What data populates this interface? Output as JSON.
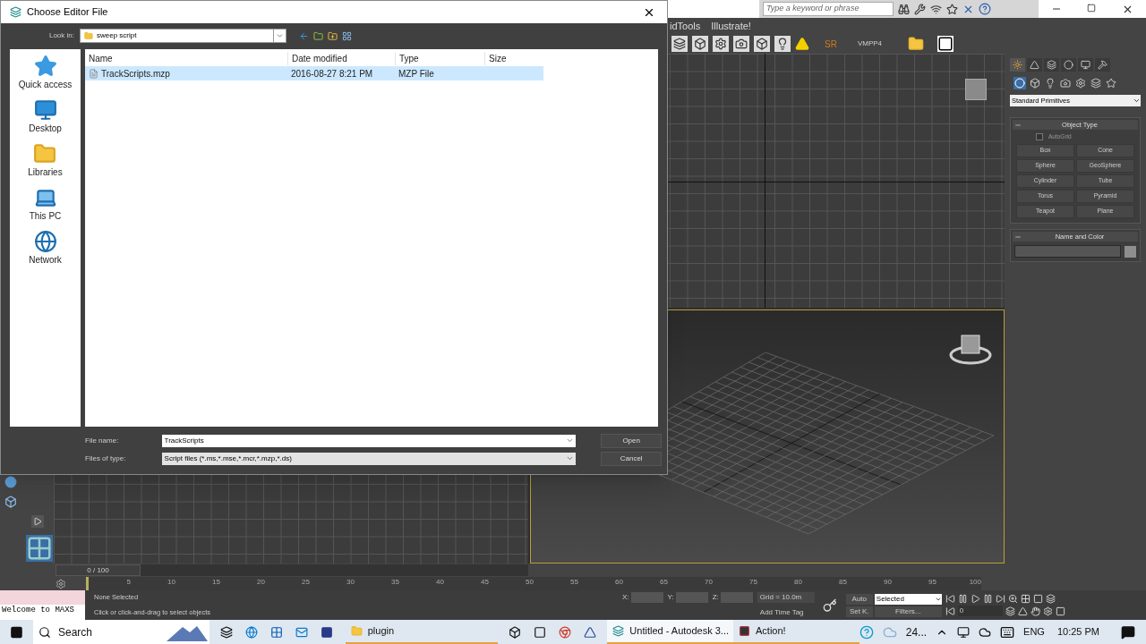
{
  "app": {
    "search_placeholder": "Type a keyword or phrase",
    "menu": [
      "idTools",
      "Illustrate!"
    ],
    "toolbar_texts": [
      "SR",
      "VMPP4"
    ]
  },
  "command_panel": {
    "dropdown": "Standard Primitives",
    "object_type": {
      "title": "Object Type",
      "expanded": true,
      "autogrid": {
        "label": "AutoGrid",
        "checked": false
      },
      "buttons": [
        "Box",
        "Cone",
        "Sphere",
        "GeoSphere",
        "Cylinder",
        "Tube",
        "Torus",
        "Pyramid",
        "Teapot",
        "Plane"
      ]
    },
    "name_and_color": {
      "title": "Name and Color",
      "expanded": true
    }
  },
  "timeline": {
    "frame_slider": "0 / 100",
    "level": 0,
    "ticks": [
      "5",
      "10",
      "15",
      "20",
      "25",
      "30",
      "35",
      "40",
      "45",
      "50",
      "55",
      "60",
      "65",
      "70",
      "75",
      "80",
      "85",
      "90",
      "95",
      "100"
    ]
  },
  "status": {
    "listener": "Welcome to MAXS",
    "selection": "None Selected",
    "prompt": "Click or click-and-drag to select objects",
    "coords": [
      "X:",
      "Y:",
      "Z:"
    ],
    "grid": "Grid = 10.0m",
    "time_tag": "Add Time Tag",
    "auto": "Auto",
    "set_key": "Set K.",
    "key_filter": "Selected",
    "filters": "Filters...",
    "frame": "0"
  },
  "dialog": {
    "title": "Choose Editor File",
    "look_in_label": "Look in:",
    "look_in": "sweep script",
    "places": [
      {
        "label": "Quick access",
        "kind": "star"
      },
      {
        "label": "Desktop",
        "kind": "desktop"
      },
      {
        "label": "Libraries",
        "kind": "folder"
      },
      {
        "label": "This PC",
        "kind": "pc"
      },
      {
        "label": "Network",
        "kind": "network"
      }
    ],
    "columns": [
      "Name",
      "Date modified",
      "Type",
      "Size"
    ],
    "files": [
      {
        "name": "TrackScripts.mzp",
        "date": "2016-08-27 8:21 PM",
        "type": "MZP File",
        "selected": true
      }
    ],
    "file_name_label": "File name:",
    "file_name": "TrackScripts",
    "file_type_label": "Files of type:",
    "file_type": "Script files (*.ms,*.mse,*.mcr,*.mzp,*.ds)",
    "buttons": [
      "Open",
      "Cancel"
    ]
  },
  "taskbar": {
    "search": "Search",
    "apps": [
      {
        "label": "plugin",
        "kind": "folder",
        "selected": false
      },
      {
        "label": "Untitled - Autodesk 3...",
        "kind": "max",
        "selected": true
      },
      {
        "label": "Action!",
        "kind": "action",
        "selected": false
      }
    ],
    "temperature": "24...",
    "language": "ENG",
    "time": "10:25 PM"
  }
}
